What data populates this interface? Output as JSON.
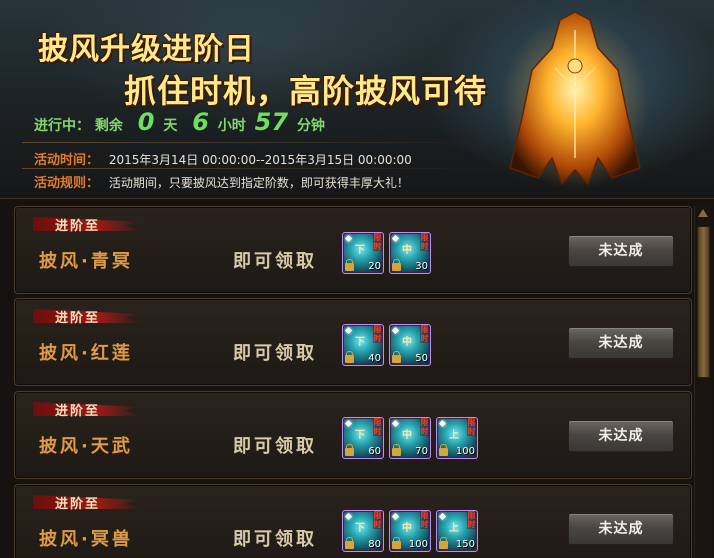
{
  "banner": {
    "title_line1": "披风升级进阶日",
    "title_line2": "抓住时机，高阶披风可待",
    "countdown": {
      "prefix": "进行中：",
      "remain_label": "剩余",
      "days": "0",
      "days_label": "天",
      "hours": "6",
      "hours_label": "小时",
      "minutes": "57",
      "minutes_label": "分钟"
    },
    "time_label": "活动时间：",
    "time_value": "2015年3月14日 00:00:00--2015年3月15日 00:00:00",
    "rules_label": "活动规则：",
    "rules_value": "活动期间，只要披风达到指定阶数，即可获得丰厚大礼！",
    "cape_icon": "cape-artwork"
  },
  "common": {
    "tag_label": "进阶至",
    "claim_label": "即可领取",
    "item_limit_label": "限时",
    "button_label": "未达成"
  },
  "rewards": [
    {
      "name": "披风·青冥",
      "items": [
        {
          "grade": "下",
          "count": "20"
        },
        {
          "grade": "中",
          "count": "30"
        }
      ]
    },
    {
      "name": "披风·红莲",
      "items": [
        {
          "grade": "下",
          "count": "40"
        },
        {
          "grade": "中",
          "count": "50"
        }
      ]
    },
    {
      "name": "披风·天武",
      "items": [
        {
          "grade": "下",
          "count": "60"
        },
        {
          "grade": "中",
          "count": "70"
        },
        {
          "grade": "上",
          "count": "100"
        }
      ]
    },
    {
      "name": "披风·冥兽",
      "items": [
        {
          "grade": "下",
          "count": "80"
        },
        {
          "grade": "中",
          "count": "100"
        },
        {
          "grade": "上",
          "count": "150"
        }
      ]
    }
  ],
  "colors": {
    "accent_gold": "#ffe98a",
    "countdown_green": "#6fe05b",
    "label_orange": "#e47a2b",
    "name_orange": "#e09a45",
    "limit_red": "#ff3a28",
    "item_border": "#c88af0"
  }
}
